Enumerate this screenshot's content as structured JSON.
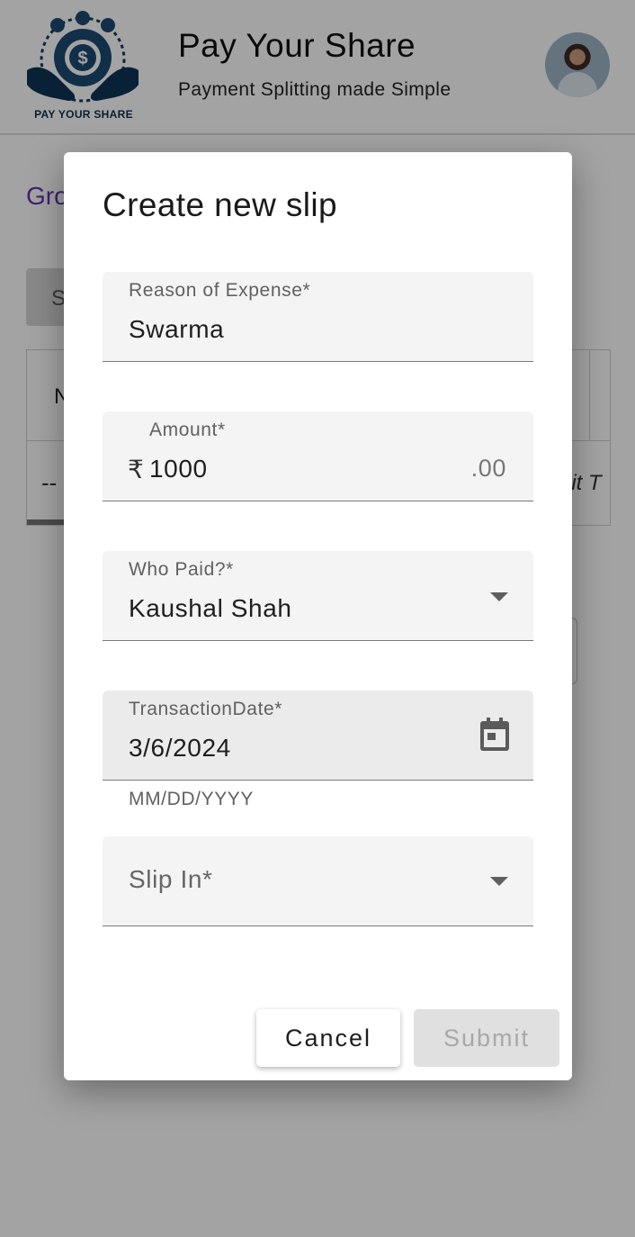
{
  "header": {
    "logo_text": "PAY YOUR SHARE",
    "title": "Pay Your Share",
    "subtitle": "Payment Splitting made Simple"
  },
  "background": {
    "group_label": "Gro",
    "chip_label": "S",
    "table_header_partial": "N",
    "table_cell_placeholder": "--",
    "table_cell_partial": "lit T"
  },
  "dialog": {
    "title": "Create new slip",
    "reason": {
      "label": "Reason of Expense*",
      "value": "Swarma"
    },
    "amount": {
      "label": "Amount*",
      "currency_symbol": "₹",
      "value": "1000",
      "suffix": ".00"
    },
    "who_paid": {
      "label": "Who Paid?*",
      "value": "Kaushal Shah"
    },
    "transaction_date": {
      "label": "TransactionDate*",
      "value": "3/6/2024",
      "helper": "MM/DD/YYYY"
    },
    "slip_in": {
      "label": "Slip In*",
      "value": ""
    },
    "cancel_label": "Cancel",
    "submit_label": "Submit"
  },
  "icons": [
    "logo-icon",
    "avatar",
    "dropdown-caret-icon",
    "calendar-icon"
  ]
}
